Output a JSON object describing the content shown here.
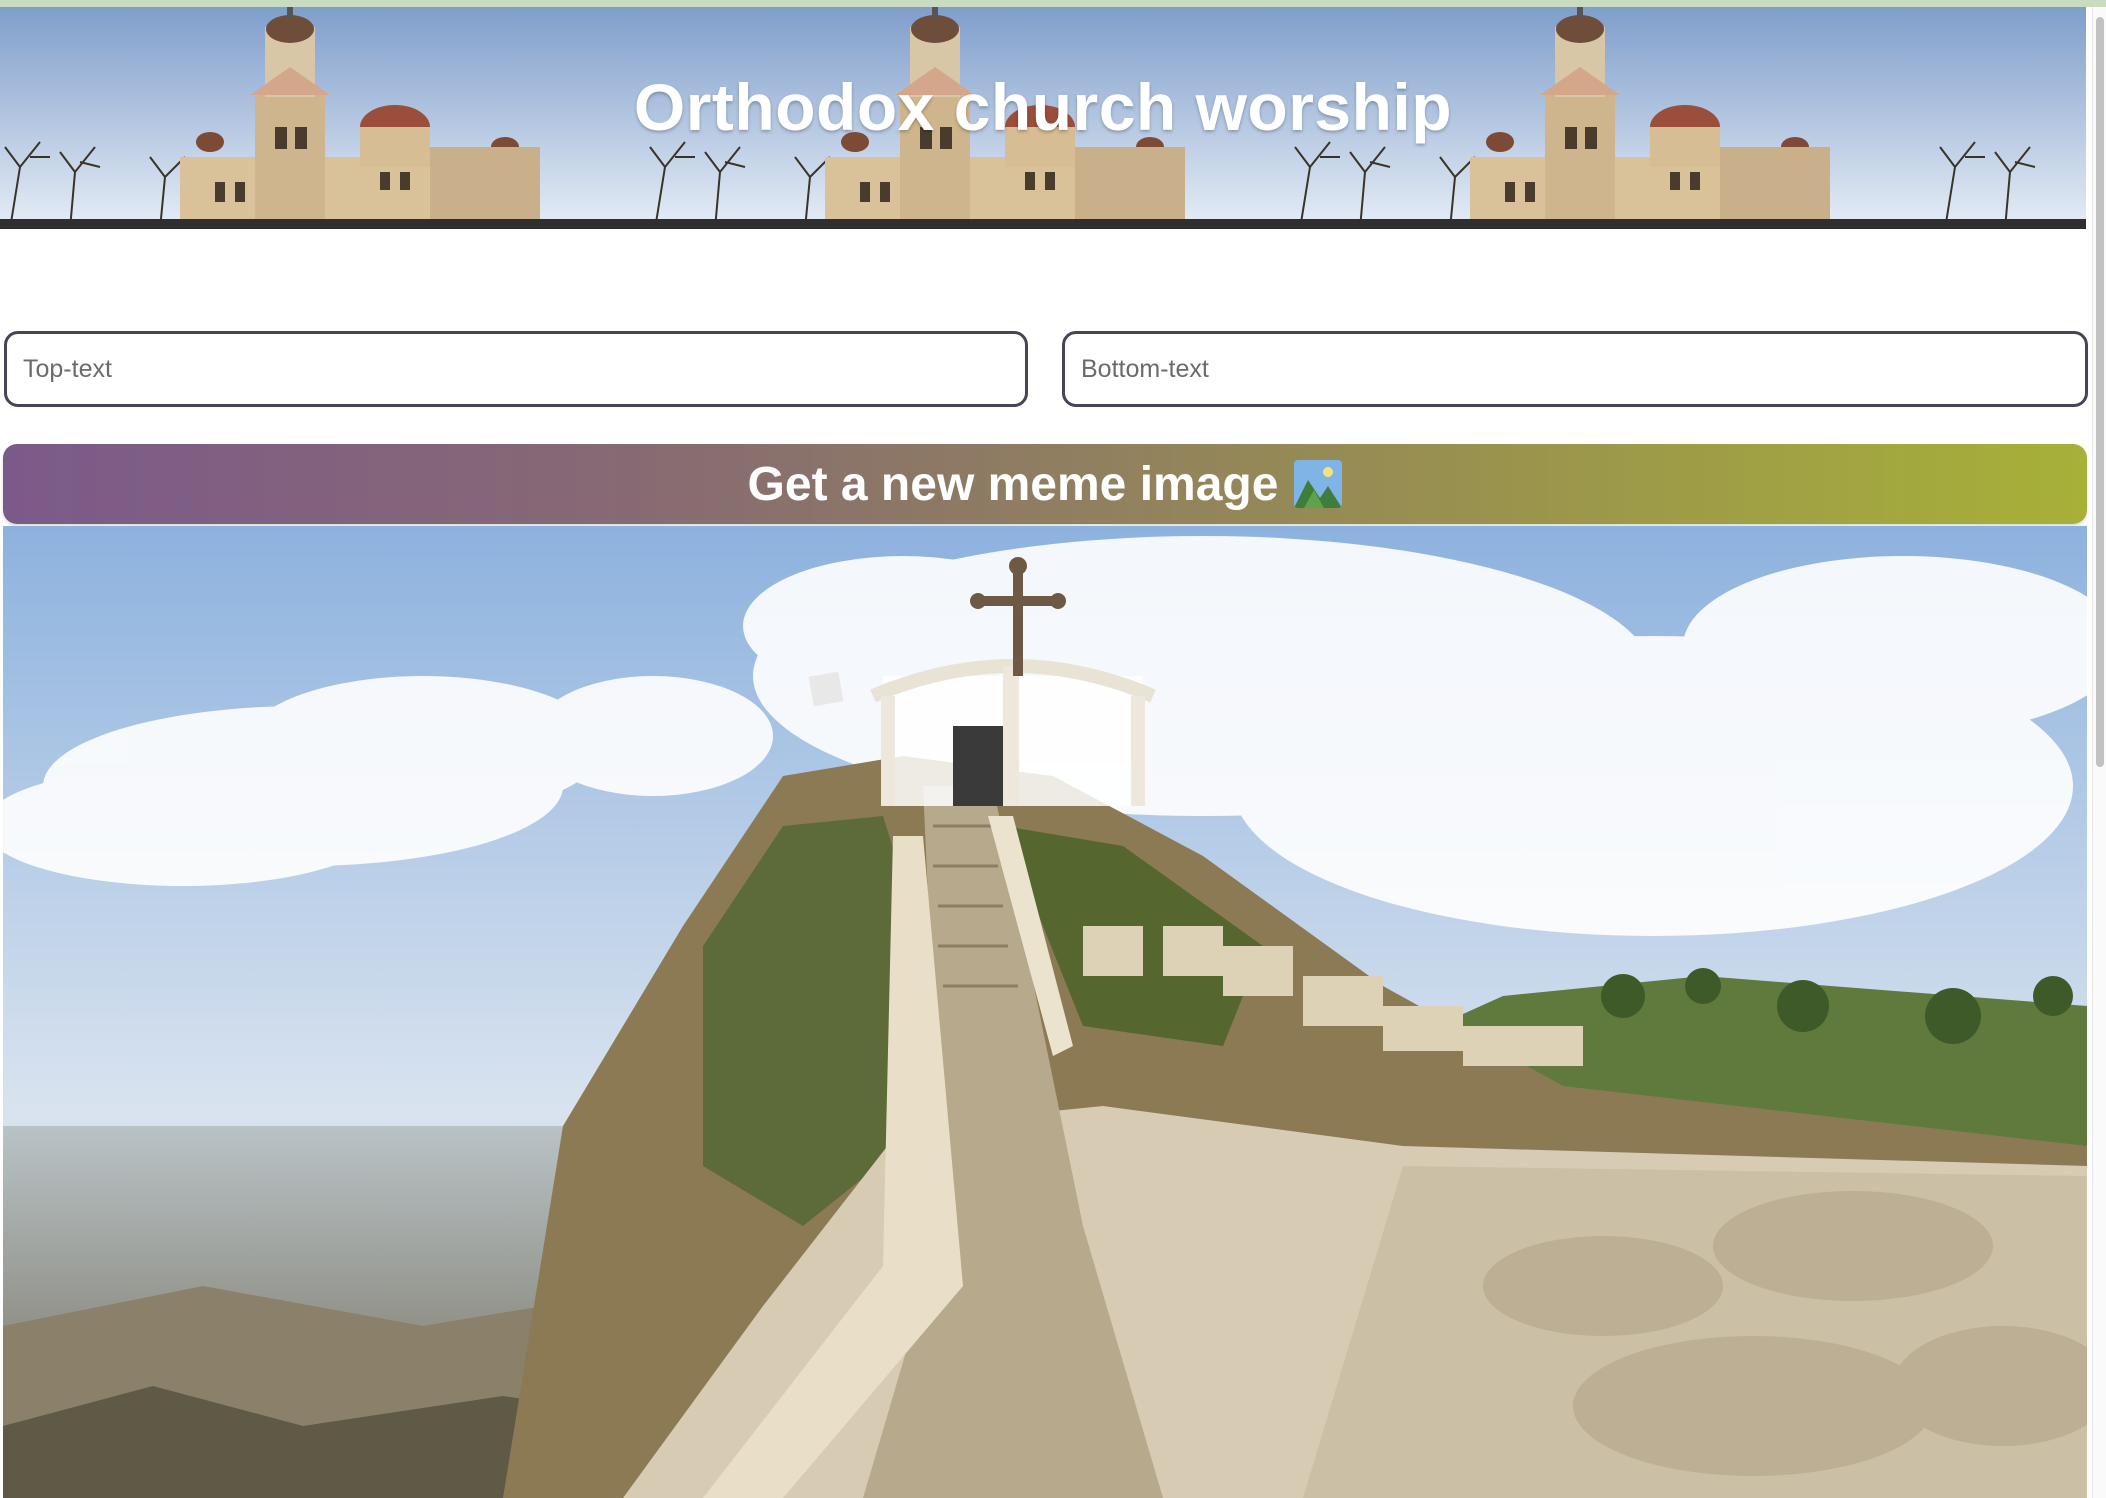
{
  "header": {
    "title": "Orthodox church worship",
    "banner_icon": "church-banner-image"
  },
  "form": {
    "top_text": {
      "value": "",
      "placeholder": "Top-text"
    },
    "bottom_text": {
      "value": "",
      "placeholder": "Bottom-text"
    }
  },
  "button": {
    "label": "Get a new meme image",
    "icon": "landscape-picture-icon"
  },
  "meme": {
    "image_icon": "hilltop-church-meme-image",
    "top_caption": "",
    "bottom_caption": ""
  },
  "colors": {
    "button_gradient_start": "#7b5a8a",
    "button_gradient_end": "#a7b138",
    "input_border": "#454557",
    "title_text": "#ffffff"
  }
}
